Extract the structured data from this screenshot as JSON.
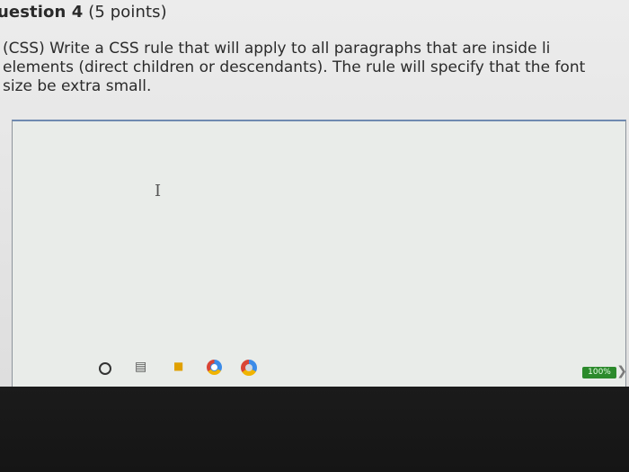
{
  "question": {
    "number_label": "uestion 4",
    "points": " (5 points)",
    "text": "(CSS) Write a CSS rule that will apply to all paragraphs that are inside li elements (direct children or descendants). The rule will specify that the font size be extra small."
  },
  "answer": {
    "value": "",
    "cursor_glyph": "I"
  },
  "taskbar": {
    "icons": [
      "search-icon",
      "task-view-icon",
      "store-icon",
      "chrome-icon",
      "chrome-profile-icon"
    ]
  },
  "status": {
    "zoom": "100%"
  }
}
